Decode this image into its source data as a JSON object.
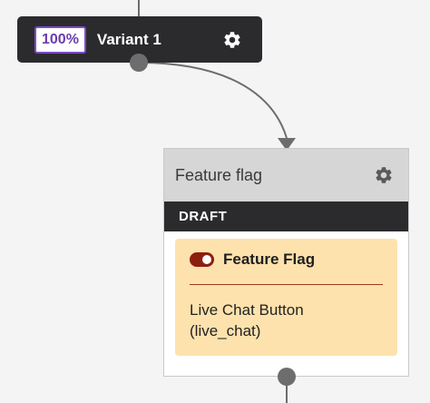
{
  "variant_node": {
    "percentage": "100%",
    "title": "Variant 1",
    "settings_icon": "gear-icon"
  },
  "feature_flag_node": {
    "header_title": "Feature flag",
    "settings_icon": "gear-icon",
    "status": "DRAFT",
    "card": {
      "title": "Feature Flag",
      "toggle_on": true,
      "toggle_color": "#8c1f10",
      "value_line1": "Live Chat Button",
      "value_line2": "(live_chat)"
    }
  },
  "colors": {
    "canvas_background": "#f4f4f5",
    "node_dark": "#2b2b2e",
    "badge_accent": "#7b4cc8",
    "header_gray": "#d6d6d6",
    "card_background": "#fde2ad",
    "connector": "#6d6d6d"
  }
}
